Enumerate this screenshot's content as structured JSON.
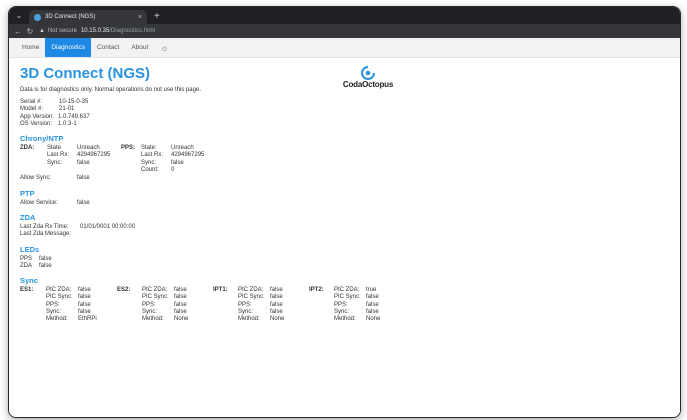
{
  "browser": {
    "tab_title": "3D Connect (NGS)",
    "tab_close": "×",
    "new_tab": "+",
    "not_secure": "Not secure",
    "url_host": "10.15.0.35",
    "url_path": "/Diagnostics.html"
  },
  "nav": {
    "items": [
      {
        "label": "Home"
      },
      {
        "label": "Diagnostics"
      },
      {
        "label": "Contact"
      },
      {
        "label": "About"
      }
    ],
    "theme_icon": "☼"
  },
  "page": {
    "title": "3D Connect (NGS)",
    "logo_text": "CodaOctopus",
    "note": "Data is for diagnostics only. Normal operations do not use this page.",
    "info": [
      {
        "k": "Serial #:",
        "v": "10-15-0-35"
      },
      {
        "k": "Model #:",
        "v": "21-01"
      },
      {
        "k": "App Version:",
        "v": "1.0.749.637"
      },
      {
        "k": "OS Version:",
        "v": "1.0.3-1"
      }
    ]
  },
  "chrony": {
    "heading": "Chrony/NTP",
    "zda_label": "ZDA:",
    "zda": [
      {
        "k": "State",
        "v": "Unreach"
      },
      {
        "k": "Last Rx:",
        "v": "4294967295"
      },
      {
        "k": "Sync:",
        "v": "false"
      }
    ],
    "pps_label": "PPS:",
    "pps": [
      {
        "k": "State:",
        "v": "Unreach"
      },
      {
        "k": "Last Rx:",
        "v": "4294967295"
      },
      {
        "k": "Sync:",
        "v": "false"
      },
      {
        "k": "Count:",
        "v": "0"
      }
    ],
    "allow_sync_label": "Allow Sync:",
    "allow_sync_value": "false"
  },
  "ptp": {
    "heading": "PTP",
    "allow_service_label": "Allow Service:",
    "allow_service_value": "false"
  },
  "zda": {
    "heading": "ZDA",
    "rx_time_label": "Last Zda Rx Time:",
    "rx_time_value": "01/01/0001 00:00:00",
    "message_label": "Last Zda Message:",
    "message_value": ""
  },
  "leds": {
    "heading": "LEDs",
    "rows": [
      {
        "k": "PPS",
        "v": "false"
      },
      {
        "k": "ZDA",
        "v": "false"
      }
    ]
  },
  "sync": {
    "heading": "Sync",
    "groups": [
      {
        "name": "ES1:",
        "rows": [
          {
            "k": "PIC ZDA:",
            "v": "false"
          },
          {
            "k": "PIC Sync:",
            "v": "false"
          },
          {
            "k": "PPS:",
            "v": "false"
          },
          {
            "k": "Sync:",
            "v": "false"
          },
          {
            "k": "Method:",
            "v": "EthRPi"
          }
        ]
      },
      {
        "name": "ES2:",
        "rows": [
          {
            "k": "PIC ZDA:",
            "v": "false"
          },
          {
            "k": "PIC Sync:",
            "v": "false"
          },
          {
            "k": "PPS:",
            "v": "false"
          },
          {
            "k": "Sync:",
            "v": "false"
          },
          {
            "k": "Method:",
            "v": "None"
          }
        ]
      },
      {
        "name": "IPT1:",
        "rows": [
          {
            "k": "PIC ZDA:",
            "v": "false"
          },
          {
            "k": "PIC Sync:",
            "v": "false"
          },
          {
            "k": "PPS:",
            "v": "false"
          },
          {
            "k": "Sync:",
            "v": "false"
          },
          {
            "k": "Method:",
            "v": "None"
          }
        ]
      },
      {
        "name": "IPT2:",
        "rows": [
          {
            "k": "PIC ZDA:",
            "v": "true"
          },
          {
            "k": "PIC Sync:",
            "v": "false"
          },
          {
            "k": "PPS:",
            "v": "false"
          },
          {
            "k": "Sync:",
            "v": "false"
          },
          {
            "k": "Method:",
            "v": "None"
          }
        ]
      }
    ]
  },
  "colors": {
    "accent": "#2a93dd",
    "active_tab": "#1e88e5"
  }
}
